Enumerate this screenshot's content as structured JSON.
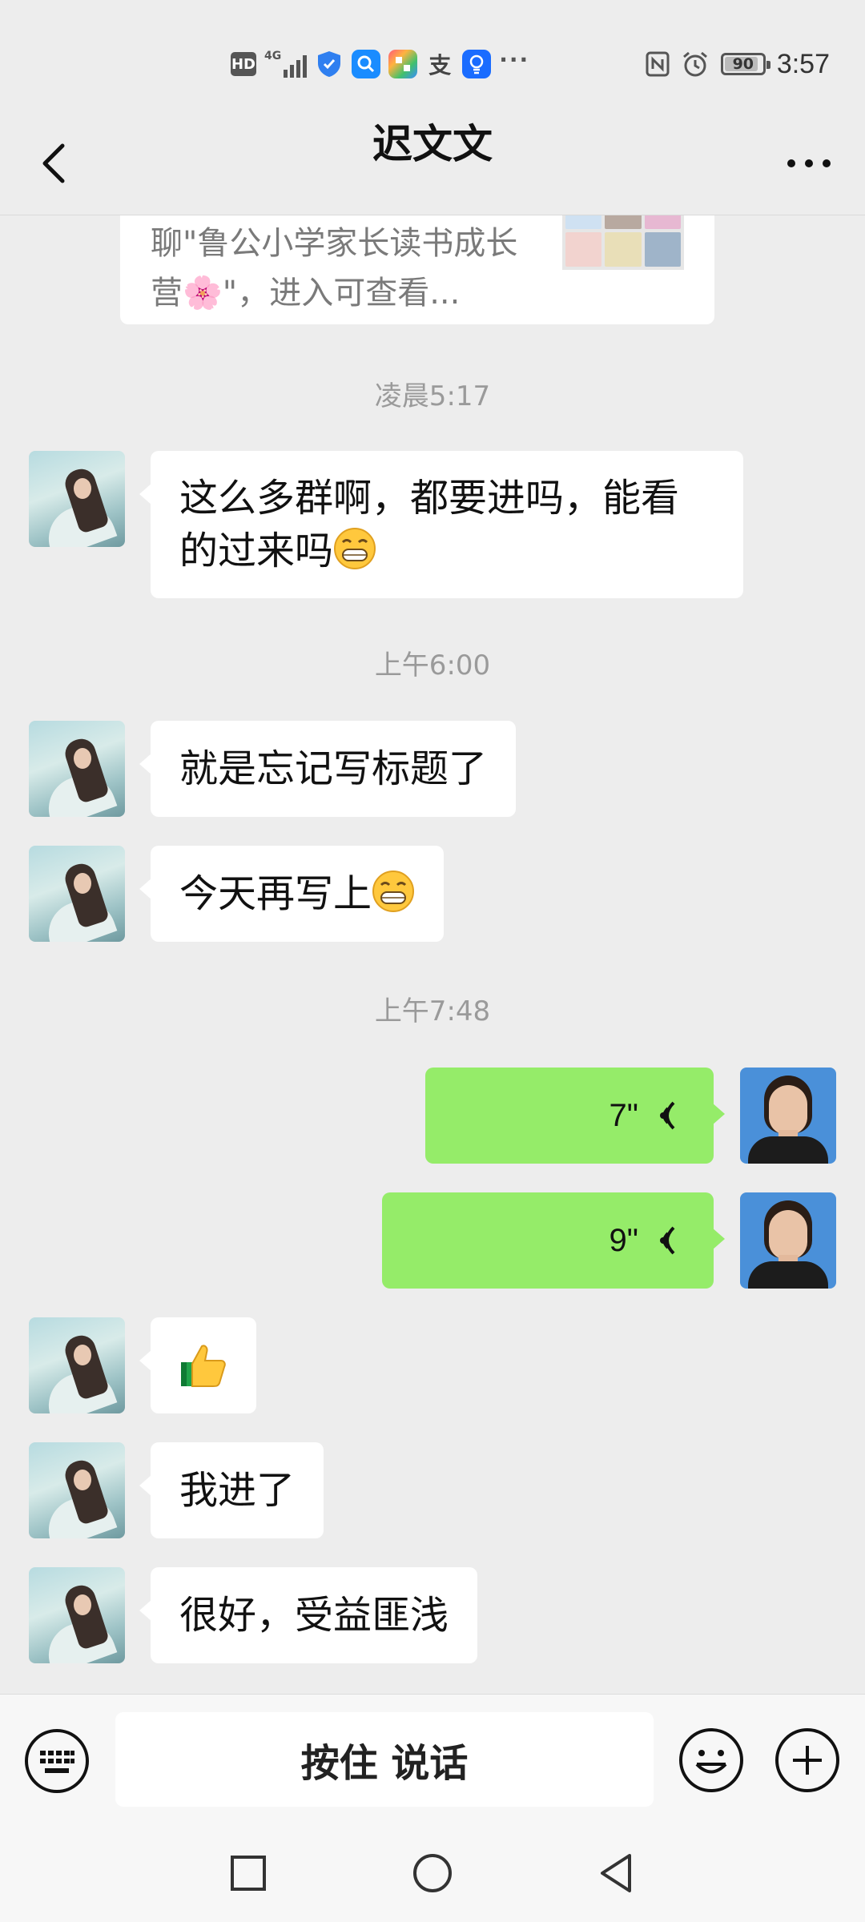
{
  "status_bar": {
    "network_label": "HD",
    "network_type": "4G",
    "battery_level": "90",
    "battery_fraction": 0.9,
    "time": "3:57",
    "icons": [
      "hd-icon",
      "signal-4g-icon",
      "shield-icon",
      "search-app-icon",
      "tiles-app-icon",
      "alipay-icon",
      "bulb-app-icon",
      "more-dots-icon",
      "nfc-icon",
      "alarm-icon",
      "battery-icon"
    ]
  },
  "header": {
    "title": "迟文文",
    "back_icon": "back-chevron-icon",
    "more_icon": "more-dots-icon"
  },
  "chat": {
    "link_card": {
      "text": "聊\"鲁公小学家长读书成长营🌸\"，进入可查看..."
    },
    "timestamps": [
      "凌晨5:17",
      "上午6:00",
      "上午7:48"
    ],
    "messages": [
      {
        "side": "left",
        "type": "text",
        "text": "这么多群啊，都要进吗，能看的过来吗",
        "emoji": "grin"
      },
      {
        "side": "left",
        "type": "text",
        "text": "就是忘记写标题了"
      },
      {
        "side": "left",
        "type": "text",
        "text": "今天再写上",
        "emoji": "grin"
      },
      {
        "side": "right",
        "type": "voice",
        "duration": "7\""
      },
      {
        "side": "right",
        "type": "voice",
        "duration": "9\""
      },
      {
        "side": "left",
        "type": "emoji",
        "emoji": "thumbs-up"
      },
      {
        "side": "left",
        "type": "text",
        "text": "我进了"
      },
      {
        "side": "left",
        "type": "text",
        "text": "很好，受益匪浅"
      }
    ]
  },
  "input_bar": {
    "hold_to_talk": "按住 说话",
    "keyboard_icon": "keyboard-icon",
    "emoji_icon": "smiley-icon",
    "plus_icon": "plus-icon"
  },
  "colors": {
    "background": "#ededed",
    "self_bubble": "#95ec69",
    "other_bubble": "#ffffff"
  }
}
